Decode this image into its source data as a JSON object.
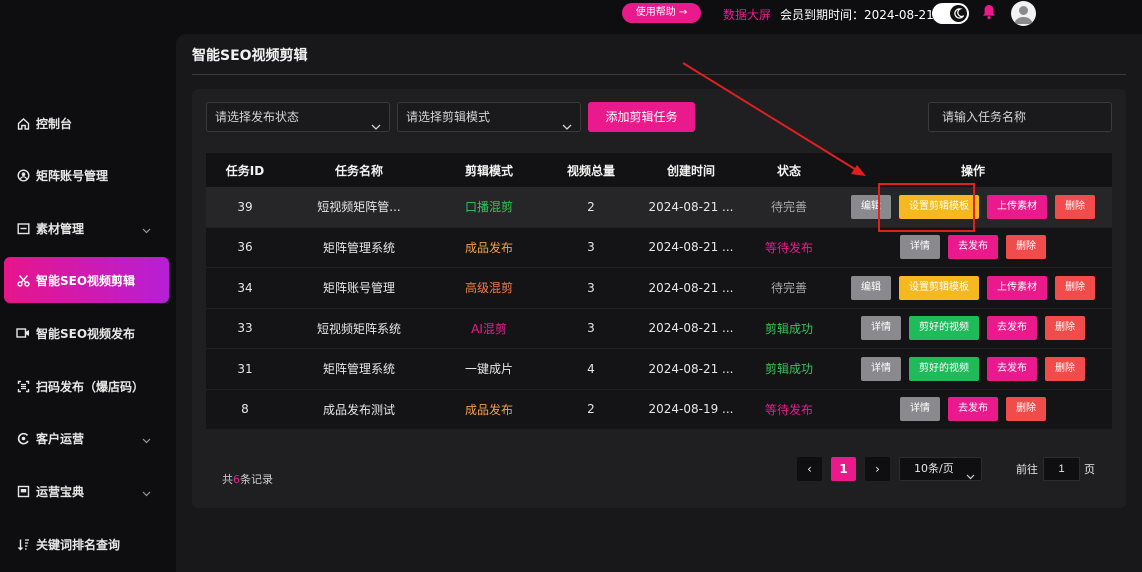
{
  "header": {
    "help_button": "使用帮助 →",
    "big_screen": "数据大屏",
    "membership_expiry": "会员到期时间：2024-08-21"
  },
  "sidebar": {
    "items": [
      {
        "label": "控制台",
        "icon": "home-icon"
      },
      {
        "label": "矩阵账号管理",
        "icon": "account-icon"
      },
      {
        "label": "素材管理",
        "icon": "folder-icon",
        "expandable": true
      },
      {
        "label": "智能SEO视频剪辑",
        "icon": "scissors-icon",
        "active": true
      },
      {
        "label": "智能SEO视频发布",
        "icon": "video-icon"
      },
      {
        "label": "扫码发布（爆店码）",
        "icon": "scan-icon"
      },
      {
        "label": "客户运营",
        "icon": "customer-icon",
        "expandable": true
      },
      {
        "label": "运营宝典",
        "icon": "book-icon",
        "expandable": true
      },
      {
        "label": "关键词排名查询",
        "icon": "sort-icon"
      }
    ]
  },
  "main": {
    "title": "智能SEO视频剪辑",
    "filters": {
      "status_placeholder": "请选择发布状态",
      "mode_placeholder": "请选择剪辑模式",
      "add_button": "添加剪辑任务",
      "search_placeholder": "请输入任务名称"
    },
    "table": {
      "headers": [
        "任务ID",
        "任务名称",
        "剪辑模式",
        "视频总量",
        "创建时间",
        "状态",
        "操作"
      ],
      "rows": [
        {
          "id": "39",
          "name": "短视频矩阵管...",
          "mode": "口播混剪",
          "mode_color": "#38c35a",
          "total": "2",
          "created": "2024-08-21 ...",
          "status": "待完善",
          "status_color": "#a8a8a8",
          "actions": [
            {
              "label": "编辑",
              "style": "gray"
            },
            {
              "label": "设置剪辑模板",
              "style": "yellow"
            },
            {
              "label": "上传素材",
              "style": "pink"
            },
            {
              "label": "删除",
              "style": "red"
            }
          ]
        },
        {
          "id": "36",
          "name": "矩阵管理系统",
          "mode": "成品发布",
          "mode_color": "#f0a04b",
          "total": "3",
          "created": "2024-08-21 ...",
          "status": "等待发布",
          "status_color": "#ea1a8c",
          "actions": [
            {
              "label": "详情",
              "style": "gray"
            },
            {
              "label": "去发布",
              "style": "pink"
            },
            {
              "label": "删除",
              "style": "red"
            }
          ]
        },
        {
          "id": "34",
          "name": "矩阵账号管理",
          "mode": "高级混剪",
          "mode_color": "#f27a4a",
          "total": "3",
          "created": "2024-08-21 ...",
          "status": "待完善",
          "status_color": "#a8a8a8",
          "actions": [
            {
              "label": "编辑",
              "style": "gray"
            },
            {
              "label": "设置剪辑模板",
              "style": "yellow"
            },
            {
              "label": "上传素材",
              "style": "pink"
            },
            {
              "label": "删除",
              "style": "red"
            }
          ]
        },
        {
          "id": "33",
          "name": "短视频矩阵系统",
          "mode": "AI混剪",
          "mode_color": "#ea1a8c",
          "total": "3",
          "created": "2024-08-21 ...",
          "status": "剪辑成功",
          "status_color": "#38c35a",
          "actions": [
            {
              "label": "详情",
              "style": "gray"
            },
            {
              "label": "剪好的视频",
              "style": "green"
            },
            {
              "label": "去发布",
              "style": "pink"
            },
            {
              "label": "删除",
              "style": "red"
            }
          ]
        },
        {
          "id": "31",
          "name": "矩阵管理系统",
          "mode": "一键成片",
          "mode_color": "#e6e6e6",
          "total": "4",
          "created": "2024-08-21 ...",
          "status": "剪辑成功",
          "status_color": "#38c35a",
          "actions": [
            {
              "label": "详情",
              "style": "gray"
            },
            {
              "label": "剪好的视频",
              "style": "green"
            },
            {
              "label": "去发布",
              "style": "pink"
            },
            {
              "label": "删除",
              "style": "red"
            }
          ]
        },
        {
          "id": "8",
          "name": "成品发布测试",
          "mode": "成品发布",
          "mode_color": "#f0a04b",
          "total": "2",
          "created": "2024-08-19 ...",
          "status": "等待发布",
          "status_color": "#ea1a8c",
          "actions": [
            {
              "label": "详情",
              "style": "gray"
            },
            {
              "label": "去发布",
              "style": "pink"
            },
            {
              "label": "删除",
              "style": "red"
            }
          ]
        }
      ]
    },
    "footer": {
      "total_prefix": "共",
      "total_count": "6",
      "total_suffix": "条记录",
      "prev": "‹",
      "current_page": "1",
      "next": "›",
      "page_size": "10条/页",
      "goto_prefix": "前往",
      "goto_value": "1",
      "goto_suffix": "页"
    }
  },
  "colors": {
    "accent": "#ea1a8c",
    "highlight_box": "#e02020"
  }
}
